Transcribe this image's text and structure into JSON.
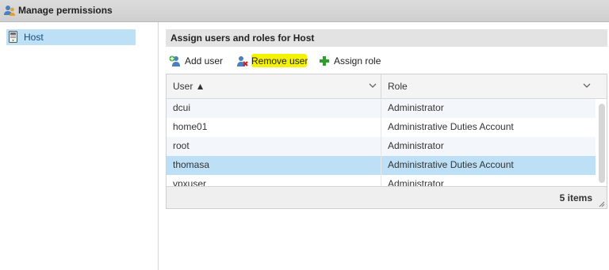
{
  "window": {
    "title": "Manage permissions",
    "icon": "users-icon"
  },
  "sidebar": {
    "items": [
      {
        "label": "Host",
        "icon": "host-icon",
        "selected": true
      }
    ]
  },
  "panel": {
    "title": "Assign users and roles for Host",
    "toolbar": {
      "add_user": "Add user",
      "remove_user": "Remove user",
      "assign_role": "Assign role"
    }
  },
  "grid": {
    "columns": [
      {
        "label": "User ▲",
        "sort": "ascending"
      },
      {
        "label": "Role"
      }
    ],
    "rows": [
      {
        "user": "dcui",
        "role": "Administrator",
        "selected": false
      },
      {
        "user": "home01",
        "role": "Administrative Duties Account",
        "selected": false
      },
      {
        "user": "root",
        "role": "Administrator",
        "selected": false
      },
      {
        "user": "thomasa",
        "role": "Administrative Duties Account",
        "selected": true
      },
      {
        "user": "vpxuser",
        "role": "Administrator",
        "selected": false
      }
    ],
    "footer": "5 items"
  },
  "colors": {
    "selected_row": "#bde0f7",
    "alt_row": "#f3f7fb",
    "highlight": "#f4f200",
    "assign_plus": "#2e9e2e",
    "remove_x": "#d22020"
  }
}
